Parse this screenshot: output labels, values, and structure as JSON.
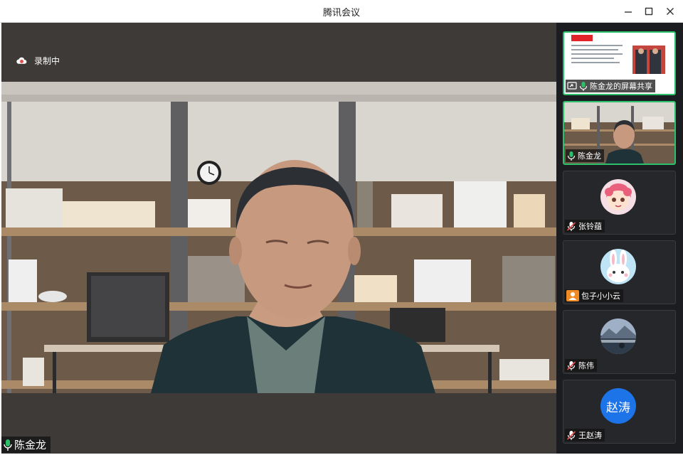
{
  "window": {
    "title": "腾讯会议"
  },
  "recording": {
    "label": "录制中",
    "icon": "cloud-record-icon"
  },
  "main_video": {
    "speaker_name": "陈金龙",
    "mic_state": "unmuted"
  },
  "participants": [
    {
      "name": "陈金龙的屏幕共享",
      "type": "screen-share",
      "mic_state": "unmuted",
      "active": true
    },
    {
      "name": "陈金龙",
      "type": "camera",
      "mic_state": "unmuted",
      "active": true
    },
    {
      "name": "张铃蕴",
      "type": "avatar",
      "mic_state": "muted",
      "avatar": "anime-girl-avatar"
    },
    {
      "name": "包子小小云",
      "type": "avatar",
      "mic_state": "none",
      "avatar": "bunny-avatar",
      "badge": "user-icon"
    },
    {
      "name": "陈伟",
      "type": "avatar",
      "mic_state": "muted",
      "avatar": "landscape-avatar"
    },
    {
      "name": "王赵涛",
      "type": "avatar",
      "mic_state": "muted",
      "avatar_text": "赵涛"
    }
  ],
  "colors": {
    "active_border": "#2cc06a",
    "mic_green": "#2cc06a",
    "mic_muted": "#e84b4b",
    "avatar_blue": "#1d73e8",
    "badge_orange": "#f08a24",
    "panel_bg": "#1c1d20"
  }
}
